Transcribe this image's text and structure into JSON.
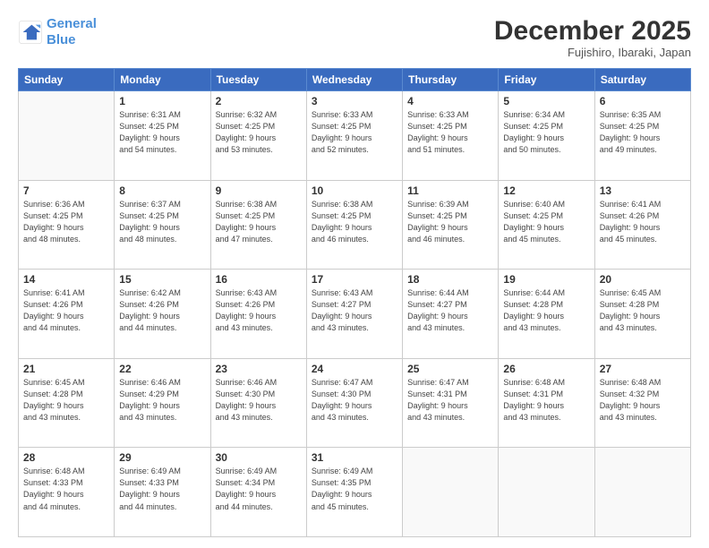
{
  "logo": {
    "line1": "General",
    "line2": "Blue"
  },
  "header": {
    "month": "December 2025",
    "location": "Fujishiro, Ibaraki, Japan"
  },
  "weekdays": [
    "Sunday",
    "Monday",
    "Tuesday",
    "Wednesday",
    "Thursday",
    "Friday",
    "Saturday"
  ],
  "weeks": [
    [
      {
        "day": "",
        "info": ""
      },
      {
        "day": "1",
        "info": "Sunrise: 6:31 AM\nSunset: 4:25 PM\nDaylight: 9 hours\nand 54 minutes."
      },
      {
        "day": "2",
        "info": "Sunrise: 6:32 AM\nSunset: 4:25 PM\nDaylight: 9 hours\nand 53 minutes."
      },
      {
        "day": "3",
        "info": "Sunrise: 6:33 AM\nSunset: 4:25 PM\nDaylight: 9 hours\nand 52 minutes."
      },
      {
        "day": "4",
        "info": "Sunrise: 6:33 AM\nSunset: 4:25 PM\nDaylight: 9 hours\nand 51 minutes."
      },
      {
        "day": "5",
        "info": "Sunrise: 6:34 AM\nSunset: 4:25 PM\nDaylight: 9 hours\nand 50 minutes."
      },
      {
        "day": "6",
        "info": "Sunrise: 6:35 AM\nSunset: 4:25 PM\nDaylight: 9 hours\nand 49 minutes."
      }
    ],
    [
      {
        "day": "7",
        "info": "Sunrise: 6:36 AM\nSunset: 4:25 PM\nDaylight: 9 hours\nand 48 minutes."
      },
      {
        "day": "8",
        "info": "Sunrise: 6:37 AM\nSunset: 4:25 PM\nDaylight: 9 hours\nand 48 minutes."
      },
      {
        "day": "9",
        "info": "Sunrise: 6:38 AM\nSunset: 4:25 PM\nDaylight: 9 hours\nand 47 minutes."
      },
      {
        "day": "10",
        "info": "Sunrise: 6:38 AM\nSunset: 4:25 PM\nDaylight: 9 hours\nand 46 minutes."
      },
      {
        "day": "11",
        "info": "Sunrise: 6:39 AM\nSunset: 4:25 PM\nDaylight: 9 hours\nand 46 minutes."
      },
      {
        "day": "12",
        "info": "Sunrise: 6:40 AM\nSunset: 4:25 PM\nDaylight: 9 hours\nand 45 minutes."
      },
      {
        "day": "13",
        "info": "Sunrise: 6:41 AM\nSunset: 4:26 PM\nDaylight: 9 hours\nand 45 minutes."
      }
    ],
    [
      {
        "day": "14",
        "info": "Sunrise: 6:41 AM\nSunset: 4:26 PM\nDaylight: 9 hours\nand 44 minutes."
      },
      {
        "day": "15",
        "info": "Sunrise: 6:42 AM\nSunset: 4:26 PM\nDaylight: 9 hours\nand 44 minutes."
      },
      {
        "day": "16",
        "info": "Sunrise: 6:43 AM\nSunset: 4:26 PM\nDaylight: 9 hours\nand 43 minutes."
      },
      {
        "day": "17",
        "info": "Sunrise: 6:43 AM\nSunset: 4:27 PM\nDaylight: 9 hours\nand 43 minutes."
      },
      {
        "day": "18",
        "info": "Sunrise: 6:44 AM\nSunset: 4:27 PM\nDaylight: 9 hours\nand 43 minutes."
      },
      {
        "day": "19",
        "info": "Sunrise: 6:44 AM\nSunset: 4:28 PM\nDaylight: 9 hours\nand 43 minutes."
      },
      {
        "day": "20",
        "info": "Sunrise: 6:45 AM\nSunset: 4:28 PM\nDaylight: 9 hours\nand 43 minutes."
      }
    ],
    [
      {
        "day": "21",
        "info": "Sunrise: 6:45 AM\nSunset: 4:28 PM\nDaylight: 9 hours\nand 43 minutes."
      },
      {
        "day": "22",
        "info": "Sunrise: 6:46 AM\nSunset: 4:29 PM\nDaylight: 9 hours\nand 43 minutes."
      },
      {
        "day": "23",
        "info": "Sunrise: 6:46 AM\nSunset: 4:30 PM\nDaylight: 9 hours\nand 43 minutes."
      },
      {
        "day": "24",
        "info": "Sunrise: 6:47 AM\nSunset: 4:30 PM\nDaylight: 9 hours\nand 43 minutes."
      },
      {
        "day": "25",
        "info": "Sunrise: 6:47 AM\nSunset: 4:31 PM\nDaylight: 9 hours\nand 43 minutes."
      },
      {
        "day": "26",
        "info": "Sunrise: 6:48 AM\nSunset: 4:31 PM\nDaylight: 9 hours\nand 43 minutes."
      },
      {
        "day": "27",
        "info": "Sunrise: 6:48 AM\nSunset: 4:32 PM\nDaylight: 9 hours\nand 43 minutes."
      }
    ],
    [
      {
        "day": "28",
        "info": "Sunrise: 6:48 AM\nSunset: 4:33 PM\nDaylight: 9 hours\nand 44 minutes."
      },
      {
        "day": "29",
        "info": "Sunrise: 6:49 AM\nSunset: 4:33 PM\nDaylight: 9 hours\nand 44 minutes."
      },
      {
        "day": "30",
        "info": "Sunrise: 6:49 AM\nSunset: 4:34 PM\nDaylight: 9 hours\nand 44 minutes."
      },
      {
        "day": "31",
        "info": "Sunrise: 6:49 AM\nSunset: 4:35 PM\nDaylight: 9 hours\nand 45 minutes."
      },
      {
        "day": "",
        "info": ""
      },
      {
        "day": "",
        "info": ""
      },
      {
        "day": "",
        "info": ""
      }
    ]
  ]
}
